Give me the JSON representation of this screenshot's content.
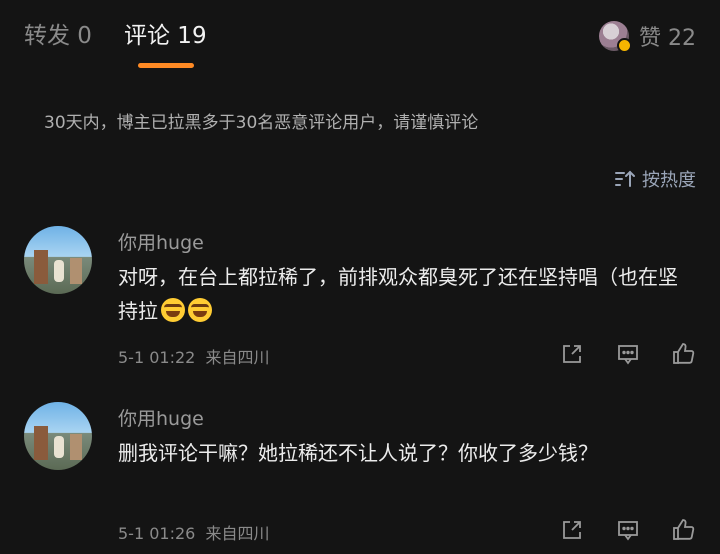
{
  "tabs": {
    "repost": "转发 0",
    "comments": "评论 19",
    "likes": "赞 22"
  },
  "notice": "30天内，博主已拉黑多于30名恶意评论用户，请谨慎评论",
  "sort": {
    "label": "按热度",
    "icon": "sort-icon"
  },
  "accent_color": "#ff8a24",
  "comments": [
    {
      "username": "你用huge",
      "text": "对呀，在台上都拉稀了，前排观众都臭死了还在坚持唱（也在坚持拉",
      "emojis": [
        "laugh-cry-emoji",
        "laugh-cry-emoji"
      ],
      "time": "5-1 01:22",
      "location": "来自四川"
    },
    {
      "username": "你用huge",
      "text": "删我评论干嘛？她拉稀还不让人说了？你收了多少钱？",
      "emojis": [],
      "time": "5-1 01:26",
      "location": "来自四川"
    }
  ],
  "action_icons": [
    "share-icon",
    "comment-icon",
    "like-icon"
  ]
}
